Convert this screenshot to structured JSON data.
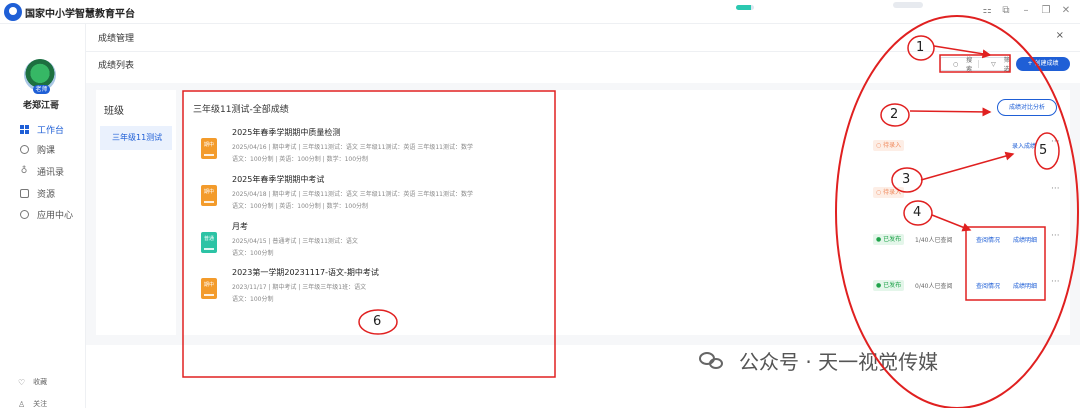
{
  "app": {
    "title": "国家中小学智慧教育平台",
    "progress_fraction": 0.85
  },
  "window": {
    "minimize_icon": "minimize-icon",
    "maximize_icon": "maximize-icon",
    "close_icon": "close-icon"
  },
  "user": {
    "role_badge": "老师",
    "name": "老郑江哥"
  },
  "sidebar": {
    "items": [
      {
        "label": "工作台",
        "icon": "grid-icon",
        "active": true
      },
      {
        "label": "购课",
        "icon": "cart-icon",
        "active": false
      },
      {
        "label": "通讯录",
        "icon": "contacts-icon",
        "active": false
      },
      {
        "label": "资源",
        "icon": "resource-icon",
        "active": false
      },
      {
        "label": "应用中心",
        "icon": "apps-icon",
        "active": false
      }
    ],
    "bottom": [
      {
        "label": "收藏",
        "icon": "heart-icon"
      },
      {
        "label": "关注",
        "icon": "user-icon"
      }
    ]
  },
  "header": {
    "breadcrumb": "成绩管理",
    "close": "×",
    "subtitle": "成绩列表"
  },
  "toolbar": {
    "search_label": "搜索",
    "filter_label": "筛选",
    "create_label": "+ 创建成绩"
  },
  "classes": {
    "heading": "班级",
    "items": [
      "三年级11测试"
    ]
  },
  "list": {
    "title": "三年级11测试-全部成绩",
    "compare_label": "成绩对比分析",
    "exams": [
      {
        "badge": "期中",
        "badge_color": "#f39b2b",
        "name": "2025年春季学期期中质量检测",
        "meta": "2025/04/16  |  期中考试  |  三年级11测试：语文  三年级11测试：英语  三年级11测试：数学",
        "meta2": "语文：100分制  |  英语：100分制  |  数学：100分制",
        "status": "○ 待录入",
        "status_type": "pending",
        "count": "",
        "actions": [
          "录入成绩"
        ],
        "more": "···"
      },
      {
        "badge": "期中",
        "badge_color": "#f39b2b",
        "name": "2025年春季学期期中考试",
        "meta": "2025/04/18  |  期中考试  |  三年级11测试：语文  三年级11测试：英语  三年级11测试：数学",
        "meta2": "语文：100分制  |  英语：100分制  |  数学：100分制",
        "status": "○ 待录入",
        "status_type": "pending",
        "count": "",
        "actions": [],
        "more": "···"
      },
      {
        "badge": "普通",
        "badge_color": "#2cc3a5",
        "name": "月考",
        "meta": "2025/04/15  |  普通考试  |  三年级11测试：语文",
        "meta2": "语文：100分制",
        "status": "● 已发布",
        "status_type": "published",
        "count": "1/40人已查阅",
        "actions": [
          "查阅情况",
          "成绩明细"
        ],
        "more": "···"
      },
      {
        "badge": "期中",
        "badge_color": "#f39b2b",
        "name": "2023第一学期20231117-语文-期中考试",
        "meta": "2023/11/17  |  期中考试  |  三年级三年级1班：语文",
        "meta2": "语文：100分制",
        "status": "● 已发布",
        "status_type": "published",
        "count": "0/40人已查阅",
        "actions": [
          "查阅情况",
          "成绩明细"
        ],
        "more": "···"
      }
    ]
  },
  "annotations": [
    "1",
    "2",
    "3",
    "4",
    "5",
    "6"
  ],
  "watermark": "公众号 · 天一视觉传媒"
}
